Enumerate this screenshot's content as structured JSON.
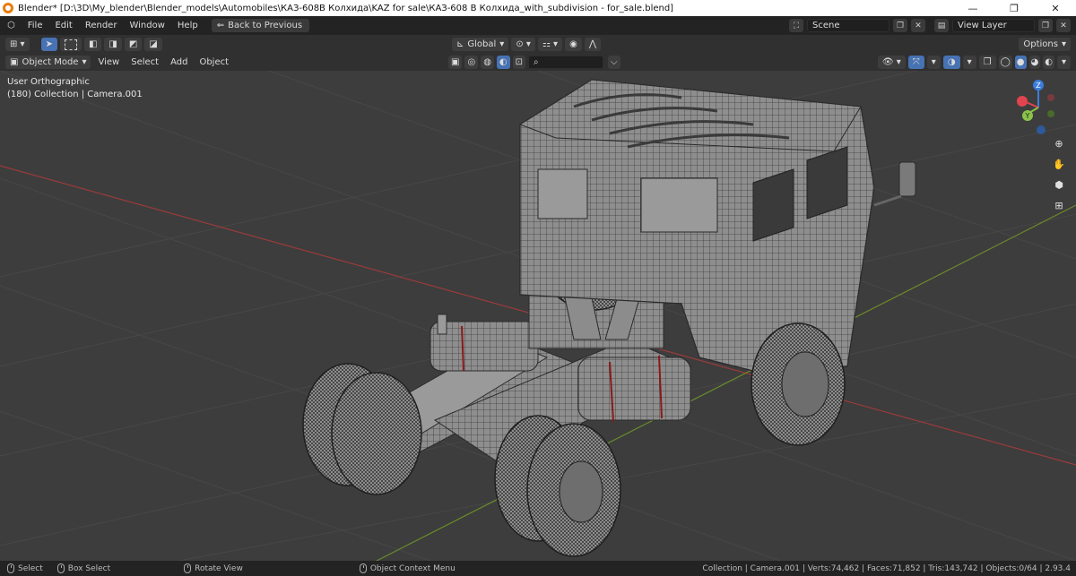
{
  "window": {
    "title": "Blender* [D:\\3D\\My_blender\\Blender_models\\Automobiles\\КАЗ-608В Колхида\\KAZ for sale\\КАЗ-608 В Колхида_with_subdivision - for_sale.blend]",
    "minimize": "—",
    "maximize": "❐",
    "close": "✕"
  },
  "menubar": {
    "items": [
      "File",
      "Edit",
      "Render",
      "Window",
      "Help"
    ],
    "back_label": "Back to Previous",
    "scene_label": "Scene",
    "view_layer_label": "View Layer"
  },
  "header": {
    "orientation": "Global",
    "options_label": "Options",
    "mode_label": "Object Mode",
    "menus": [
      "View",
      "Select",
      "Add",
      "Object"
    ],
    "search_placeholder": ""
  },
  "viewport": {
    "view_name": "User Orthographic",
    "collection_info": "(180) Collection | Camera.001",
    "gizmo": {
      "x": "X",
      "y": "Y",
      "z": "Z"
    },
    "colors": {
      "background": "#3d3d3d",
      "grid": "#4a4a4a",
      "x_axis": "#9a3b3b",
      "y_axis": "#6b8a2a",
      "x_gizmo": "#e0444e",
      "y_gizmo": "#8bc34a",
      "z_gizmo": "#3b7ddd"
    }
  },
  "statusbar": {
    "select": "Select",
    "box_select": "Box Select",
    "rotate_view": "Rotate View",
    "context_menu": "Object Context Menu",
    "stats": "Collection | Camera.001 | Verts:74,462 | Faces:71,852 | Tris:143,742 | Objects:0/64 | 2.93.4"
  }
}
